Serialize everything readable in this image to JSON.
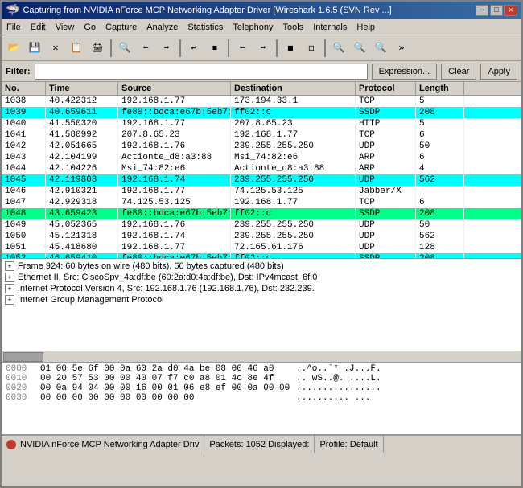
{
  "window": {
    "title": "Capturing from NVIDIA nForce MCP Networking Adapter Driver   [Wireshark 1.6.5 (SVN Rev ...]",
    "icon": "wireshark-icon"
  },
  "title_buttons": {
    "minimize": "─",
    "maximize": "□",
    "close": "✕"
  },
  "menu": {
    "items": [
      "File",
      "Edit",
      "View",
      "Go",
      "Capture",
      "Analyze",
      "Statistics",
      "Telephony",
      "Tools",
      "Internals",
      "Help"
    ]
  },
  "toolbar": {
    "buttons": [
      "📂",
      "💾",
      "✕",
      "🔍",
      "⬅",
      "➡",
      "⬅",
      "↺",
      "⬅",
      "➡",
      "⬜",
      "⬜",
      "⬜",
      "⬜",
      "🔍",
      "🔍",
      "🔍"
    ]
  },
  "filter": {
    "label": "Filter:",
    "placeholder": "",
    "expression_btn": "Expression...",
    "clear_btn": "Clear",
    "apply_btn": "Apply"
  },
  "packet_list": {
    "headers": [
      "No.",
      "Time",
      "Source",
      "Destination",
      "Protocol",
      "Length"
    ],
    "rows": [
      {
        "no": "1038",
        "time": "40.422312",
        "src": "192.168.1.77",
        "dst": "173.194.33.1",
        "proto": "TCP",
        "len": "5",
        "style": "white"
      },
      {
        "no": "1039",
        "time": "40.659611",
        "src": "fe80::bdca:e67b:5eb7:",
        "dst": "ff02::c",
        "proto": "SSDP",
        "len": "208",
        "style": "cyan"
      },
      {
        "no": "1040",
        "time": "41.550320",
        "src": "192.168.1.77",
        "dst": "207.8.65.23",
        "proto": "HTTP",
        "len": "5",
        "style": "white"
      },
      {
        "no": "1041",
        "time": "41.580992",
        "src": "207.8.65.23",
        "dst": "192.168.1.77",
        "proto": "TCP",
        "len": "6",
        "style": "white"
      },
      {
        "no": "1042",
        "time": "42.051665",
        "src": "192.168.1.76",
        "dst": "239.255.255.250",
        "proto": "UDP",
        "len": "50",
        "style": "white"
      },
      {
        "no": "1043",
        "time": "42.104199",
        "src": "Actionte_d8:a3:88",
        "dst": "Msi_74:82:e6",
        "proto": "ARP",
        "len": "6",
        "style": "white"
      },
      {
        "no": "1044",
        "time": "42.104226",
        "src": "Msi_74:82:e6",
        "dst": "Actionte_d8:a3:88",
        "proto": "ARP",
        "len": "4",
        "style": "white"
      },
      {
        "no": "1045",
        "time": "42.119803",
        "src": "192.168.1.74",
        "dst": "239.255.255.250",
        "proto": "UDP",
        "len": "562",
        "style": "cyan"
      },
      {
        "no": "1046",
        "time": "42.910321",
        "src": "192.168.1.77",
        "dst": "74.125.53.125",
        "proto": "Jabber/X",
        "len": "",
        "style": "white"
      },
      {
        "no": "1047",
        "time": "42.929318",
        "src": "74.125.53.125",
        "dst": "192.168.1.77",
        "proto": "TCP",
        "len": "6",
        "style": "white"
      },
      {
        "no": "1048",
        "time": "43.659423",
        "src": "fe80::bdca:e67b:5eb7:",
        "dst": "ff02::c",
        "proto": "SSDP",
        "len": "208",
        "style": "green"
      },
      {
        "no": "1049",
        "time": "45.052365",
        "src": "192.168.1.76",
        "dst": "239.255.255.250",
        "proto": "UDP",
        "len": "50",
        "style": "white"
      },
      {
        "no": "1050",
        "time": "45.121318",
        "src": "192.168.1.74",
        "dst": "239.255.255.250",
        "proto": "UDP",
        "len": "562",
        "style": "white"
      },
      {
        "no": "1051",
        "time": "45.418680",
        "src": "192.168.1.77",
        "dst": "72.165.61.176",
        "proto": "UDP",
        "len": "128",
        "style": "white"
      },
      {
        "no": "1052",
        "time": "46.659410",
        "src": "fe80::bdca:e67b:5eb7:",
        "dst": "ff02::c",
        "proto": "SSDP",
        "len": "208",
        "style": "cyan"
      }
    ]
  },
  "detail_panel": {
    "rows": [
      {
        "text": "Frame 924: 60 bytes on wire (480 bits), 60 bytes captured (480 bits)",
        "expanded": false
      },
      {
        "text": "Ethernet II, Src: CiscoSpv_4a:df:be (60:2a:d0:4a:df:be), Dst: IPv4mcast_6f:0",
        "expanded": false
      },
      {
        "text": "Internet Protocol Version 4, Src: 192.168.1.76 (192.168.1.76), Dst: 232.239.",
        "expanded": false
      },
      {
        "text": "Internet Group Management Protocol",
        "expanded": false
      }
    ]
  },
  "hex_dump": {
    "lines": [
      {
        "offset": "0000",
        "bytes": "01 00 5e 6f 00 0a 60 2a  d0 4a be 08 00 46 a0",
        "ascii": "..^o..`* .J...F."
      },
      {
        "offset": "0010",
        "bytes": "00 20 57 53 00 00 40 07  f7 c0 a8 01 4c 8e 4f",
        "ascii": ".. wS..@. ....L."
      },
      {
        "offset": "0020",
        "bytes": "00 0a 94 04 00 00 16 00  01 06 e8 ef 00 0a 00 00",
        "ascii": "................ "
      },
      {
        "offset": "0030",
        "bytes": "00 00 00 00 00 00 00 00  00 00",
        "ascii": "..........  ..."
      }
    ]
  },
  "status_bar": {
    "capture_name": "NVIDIA nForce MCP Networking Adapter Driv",
    "packets_info": "Packets: 1052  Displayed:",
    "profile": "Profile: Default"
  }
}
